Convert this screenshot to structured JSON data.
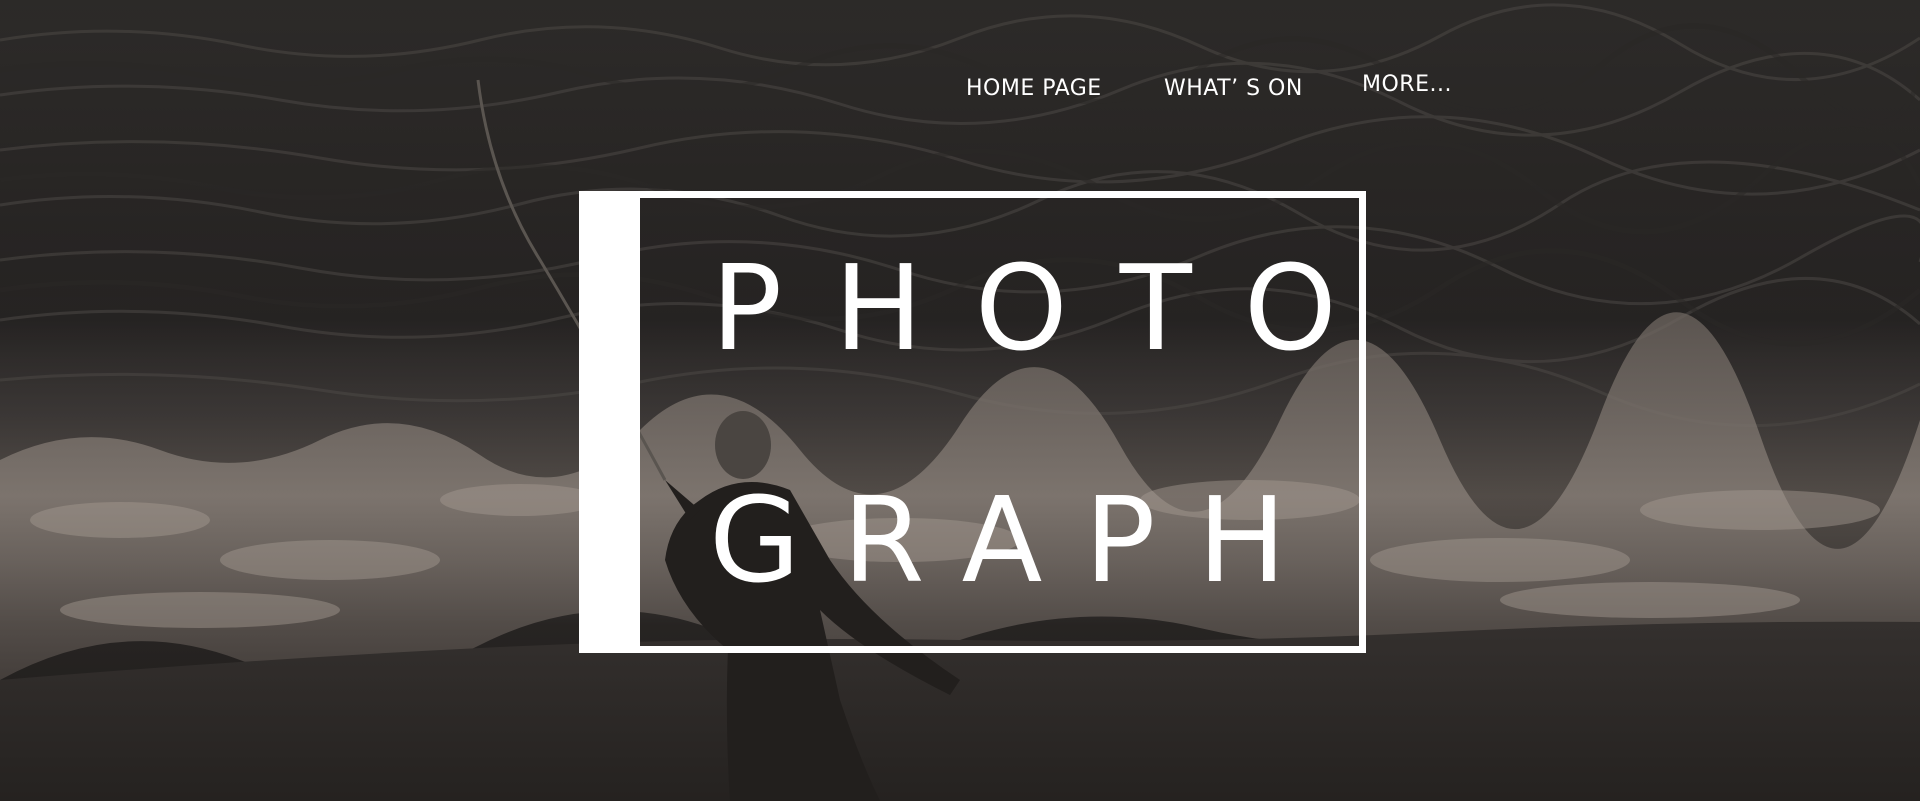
{
  "nav": {
    "items": [
      {
        "label": "HOME PAGE"
      },
      {
        "label": "WHAT’ S ON"
      },
      {
        "label": "MORE..."
      }
    ]
  },
  "logo": {
    "line1": "PHOTO",
    "line2": "GRAPH"
  },
  "colors": {
    "text": "#ffffff",
    "overlay": "#1e1d1c"
  },
  "background": {
    "subject": "fisherman-on-beach-photo"
  }
}
